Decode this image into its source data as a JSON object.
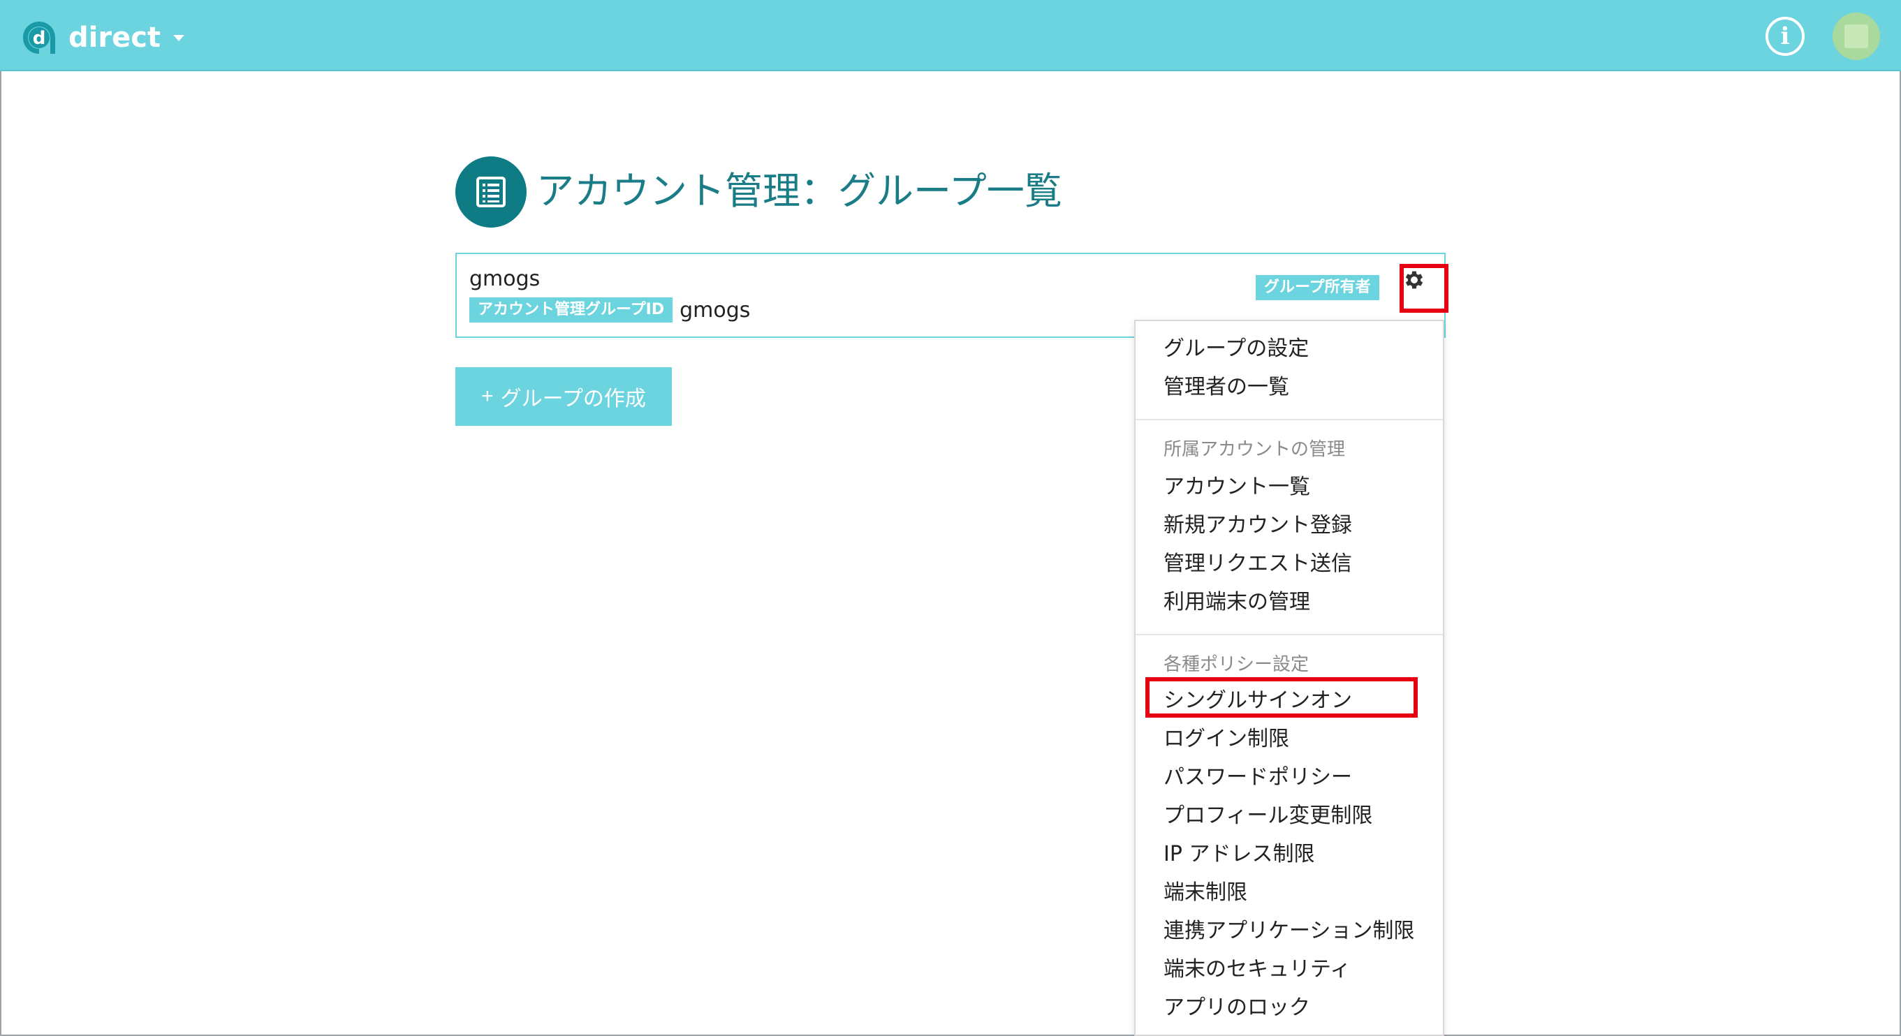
{
  "app": {
    "name": "direct",
    "accent_color": "#6bd4df",
    "title_color": "#1a7c86",
    "highlight_color": "#e60012"
  },
  "header": {
    "logo_icon": "direct-logo-icon",
    "info_icon": "info-icon",
    "info_glyph": "i",
    "avatar": "user-avatar"
  },
  "page": {
    "title": "アカウント管理：グループ一覧",
    "title_icon": "list-icon"
  },
  "group": {
    "name": "gmogs",
    "id_label": "アカウント管理グループID",
    "id_value": "gmogs",
    "owner_badge": "グループ所有者",
    "settings_icon": "gear-icon"
  },
  "create_button": {
    "plus": "+",
    "label": "グループの作成"
  },
  "menu": {
    "items_top": [
      "グループの設定",
      "管理者の一覧"
    ],
    "section_accounts": {
      "header": "所属アカウントの管理",
      "items": [
        "アカウント一覧",
        "新規アカウント登録",
        "管理リクエスト送信",
        "利用端末の管理"
      ]
    },
    "section_policies": {
      "header": "各種ポリシー設定",
      "items": [
        "シングルサインオン",
        "ログイン制限",
        "パスワードポリシー",
        "プロフィール変更制限",
        "IP アドレス制限",
        "端末制限",
        "連携アプリケーション制限",
        "端末のセキュリティ",
        "アプリのロック"
      ]
    }
  }
}
